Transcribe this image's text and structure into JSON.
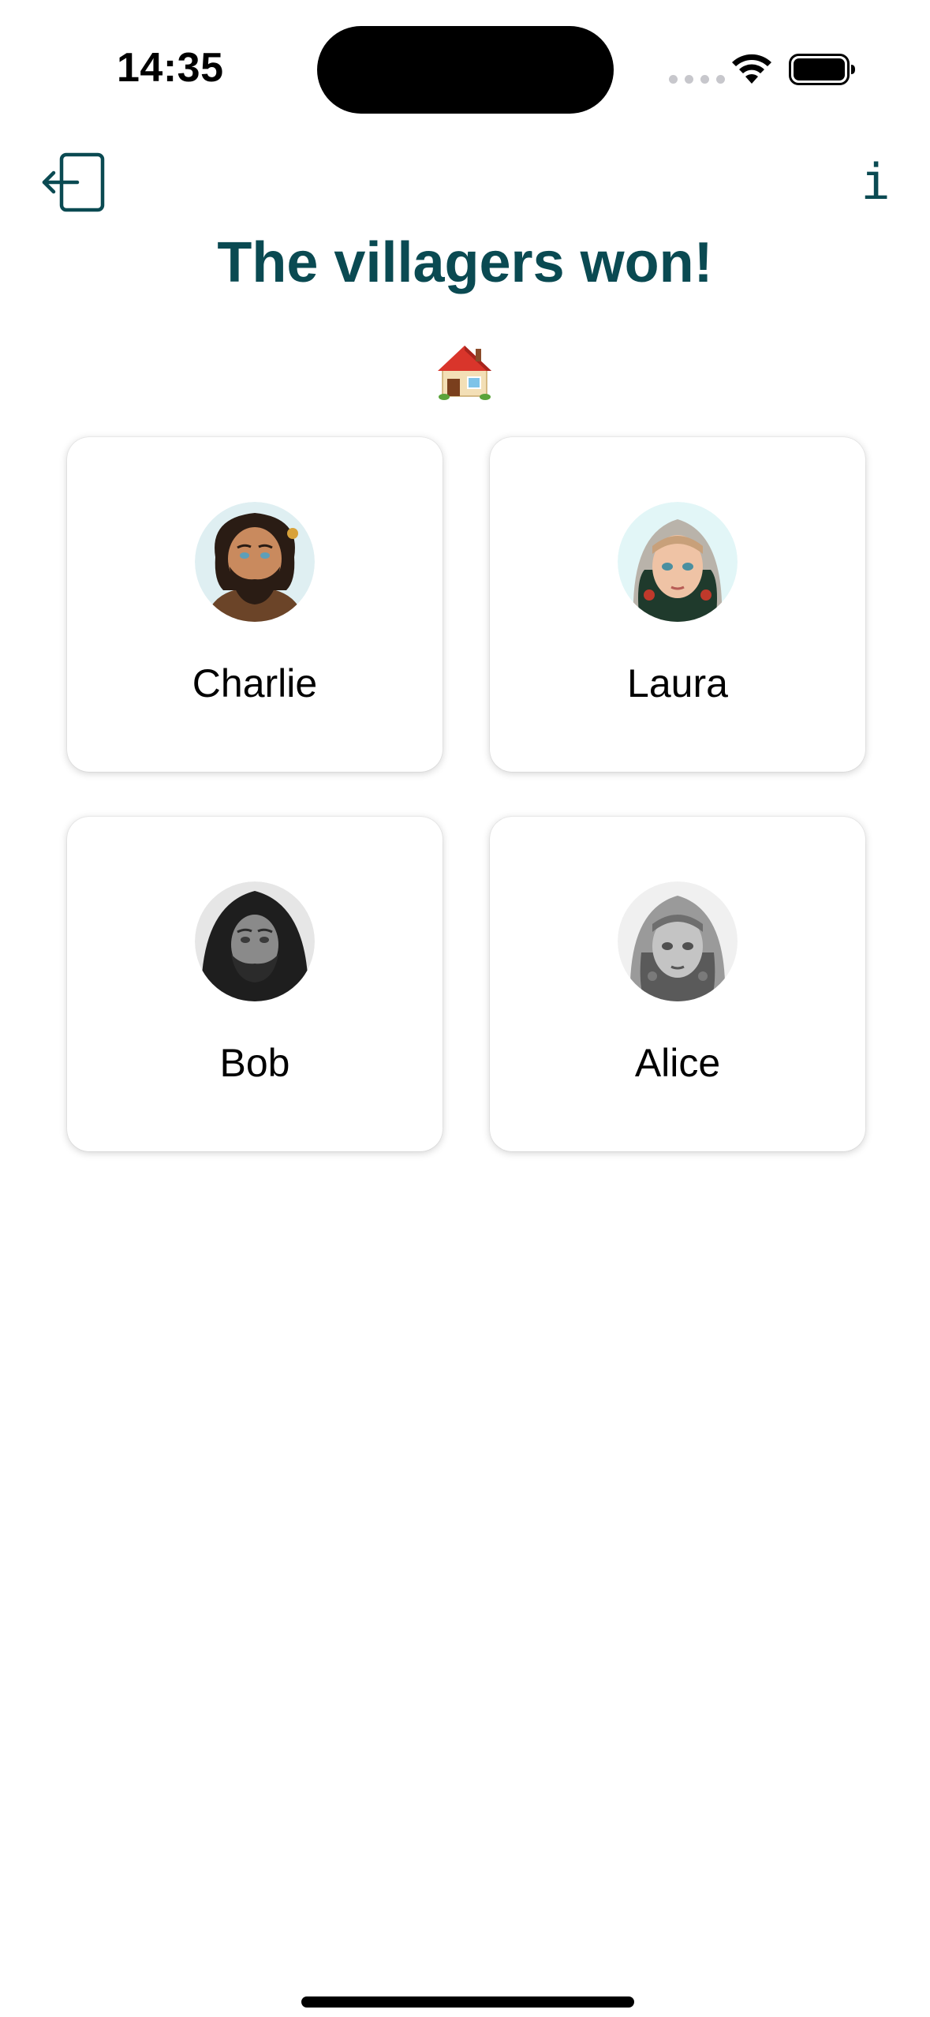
{
  "status_bar": {
    "time": "14:35"
  },
  "nav": {
    "exit_icon": "exit-door-icon",
    "info_label": "i"
  },
  "title": "The villagers won!",
  "winner_icon": "house-icon",
  "colors": {
    "accent": "#0a4a52",
    "card_background": "#ffffff",
    "text": "#000000"
  },
  "players": [
    {
      "name": "Charlie",
      "avatar": "bearded-man-portrait",
      "style": "color"
    },
    {
      "name": "Laura",
      "avatar": "hooded-woman-portrait",
      "style": "color"
    },
    {
      "name": "Bob",
      "avatar": "hooded-man-portrait",
      "style": "grayscale"
    },
    {
      "name": "Alice",
      "avatar": "girl-headscarf-portrait",
      "style": "grayscale"
    }
  ]
}
